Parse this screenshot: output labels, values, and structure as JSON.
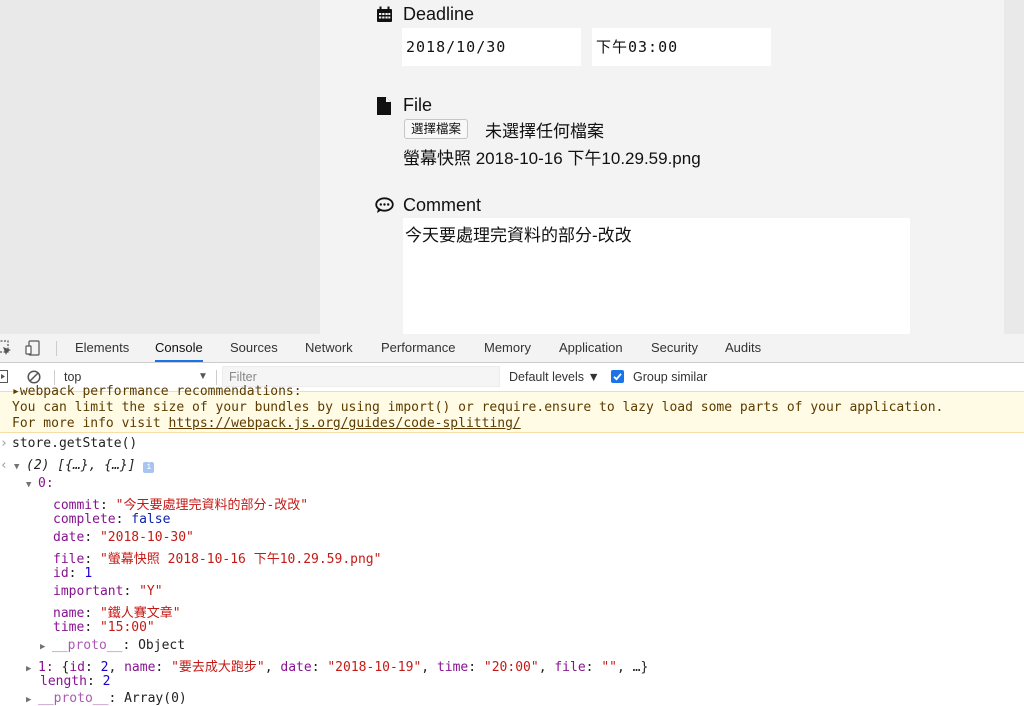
{
  "form": {
    "deadline": {
      "label": "Deadline",
      "date": "2018/10/30",
      "time": "下午03:00"
    },
    "file": {
      "label": "File",
      "button": "選擇檔案",
      "none_chosen": "未選擇任何檔案",
      "filename": "螢幕快照 2018-10-16 下午10.29.59.png"
    },
    "comment": {
      "label": "Comment",
      "value": "今天要處理完資料的部分-改改"
    }
  },
  "devtools": {
    "tabs": [
      "Elements",
      "Console",
      "Sources",
      "Network",
      "Performance",
      "Memory",
      "Application",
      "Security",
      "Audits"
    ],
    "active_tab": "Console",
    "toolbar": {
      "context": "top",
      "filter_placeholder": "Filter",
      "levels": "Default levels ▼",
      "group_similar": "Group similar"
    },
    "warning": {
      "cut_line": "▸webpack performance recommendations:",
      "line1": "You can limit the size of your bundles by using import() or require.ensure to lazy load some parts of your application.",
      "line2_prefix": "For more info visit ",
      "link": "https://webpack.js.org/guides/code-splitting/"
    },
    "console": {
      "command": "store.getState()",
      "array_summary": "(2) [{…}, {…}]",
      "item0_label": "0:",
      "fields": [
        {
          "key": "commit",
          "value": "\"今天要處理完資料的部分-改改\"",
          "kind": "str"
        },
        {
          "key": "complete",
          "value": "false",
          "kind": "kw"
        },
        {
          "key": "date",
          "value": "\"2018-10-30\"",
          "kind": "str"
        },
        {
          "key": "file",
          "value": "\"螢幕快照 2018-10-16 下午10.29.59.png\"",
          "kind": "str"
        },
        {
          "key": "id",
          "value": "1",
          "kind": "num"
        },
        {
          "key": "important",
          "value": "\"Y\"",
          "kind": "str"
        },
        {
          "key": "name",
          "value": "\"鐵人賽文章\"",
          "kind": "str"
        },
        {
          "key": "time",
          "value": "\"15:00\"",
          "kind": "str"
        }
      ],
      "proto_object": {
        "key": "__proto__",
        "value": "Object"
      },
      "item1": {
        "label": "1:",
        "open": "{",
        "id_key": "id",
        "id_val": "2",
        "name_key": "name",
        "name_val": "\"要去成大跑步\"",
        "date_key": "date",
        "date_val": "\"2018-10-19\"",
        "time_key": "time",
        "time_val": "\"20:00\"",
        "file_key": "file",
        "file_val": "\"\"",
        "close": "…}"
      },
      "length": {
        "key": "length",
        "value": "2"
      },
      "proto_array": {
        "key": "__proto__",
        "value": "Array(0)"
      }
    }
  }
}
